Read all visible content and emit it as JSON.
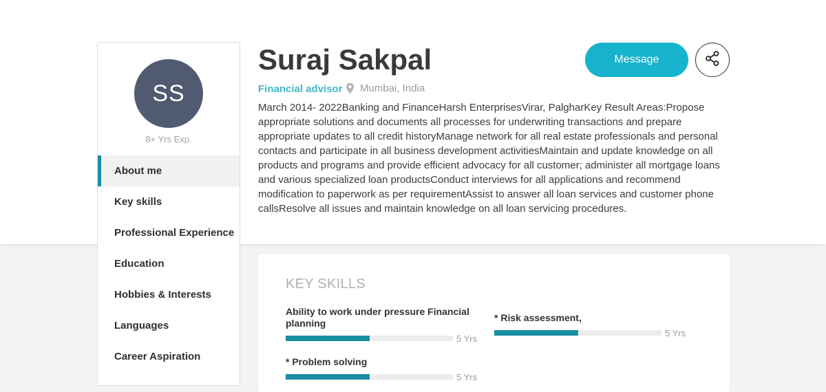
{
  "profile": {
    "initials": "SS",
    "experience": "8+ Yrs Exp.",
    "name": "Suraj Sakpal",
    "role": "Financial advisor",
    "location": "Mumbai, India",
    "about": "March 2014- 2022Banking and FinanceHarsh EnterprisesVirar, PalgharKey Result Areas:Propose appropriate solutions and documents all processes for underwriting transactions and prepare appropriate updates to all credit historyManage network for all real estate professionals and personal contacts and participate in all business development activitiesMaintain and update knowledge on all products and programs and provide efficient advocacy for all customer; administer all mortgage loans and various specialized loan productsConduct interviews for all applications and recommend modification to paperwork as per requirementAssist to answer all loan services and customer phone callsResolve all issues and maintain knowledge on all loan servicing procedures.",
    "avatar_color": "#505a70"
  },
  "actions": {
    "message_label": "Message",
    "share_icon": "share-icon",
    "accent": "#17b3cc"
  },
  "sidebar": {
    "items": [
      {
        "label": "About me",
        "active": true
      },
      {
        "label": "Key skills"
      },
      {
        "label": "Professional Experience"
      },
      {
        "label": "Education"
      },
      {
        "label": "Hobbies & Interests"
      },
      {
        "label": "Languages"
      },
      {
        "label": "Career Aspiration"
      }
    ]
  },
  "skills": {
    "title": "KEY SKILLS",
    "items": [
      {
        "name": "Ability to work under pressure Financial planning",
        "years": "5 Yrs",
        "level": 0.5
      },
      {
        "name": "* Risk assessment,",
        "years": "5 Yrs",
        "level": 0.5
      },
      {
        "name": "* Problem solving",
        "years": "5 Yrs",
        "level": 0.5
      }
    ],
    "bar_color": "#1a8ea2"
  }
}
